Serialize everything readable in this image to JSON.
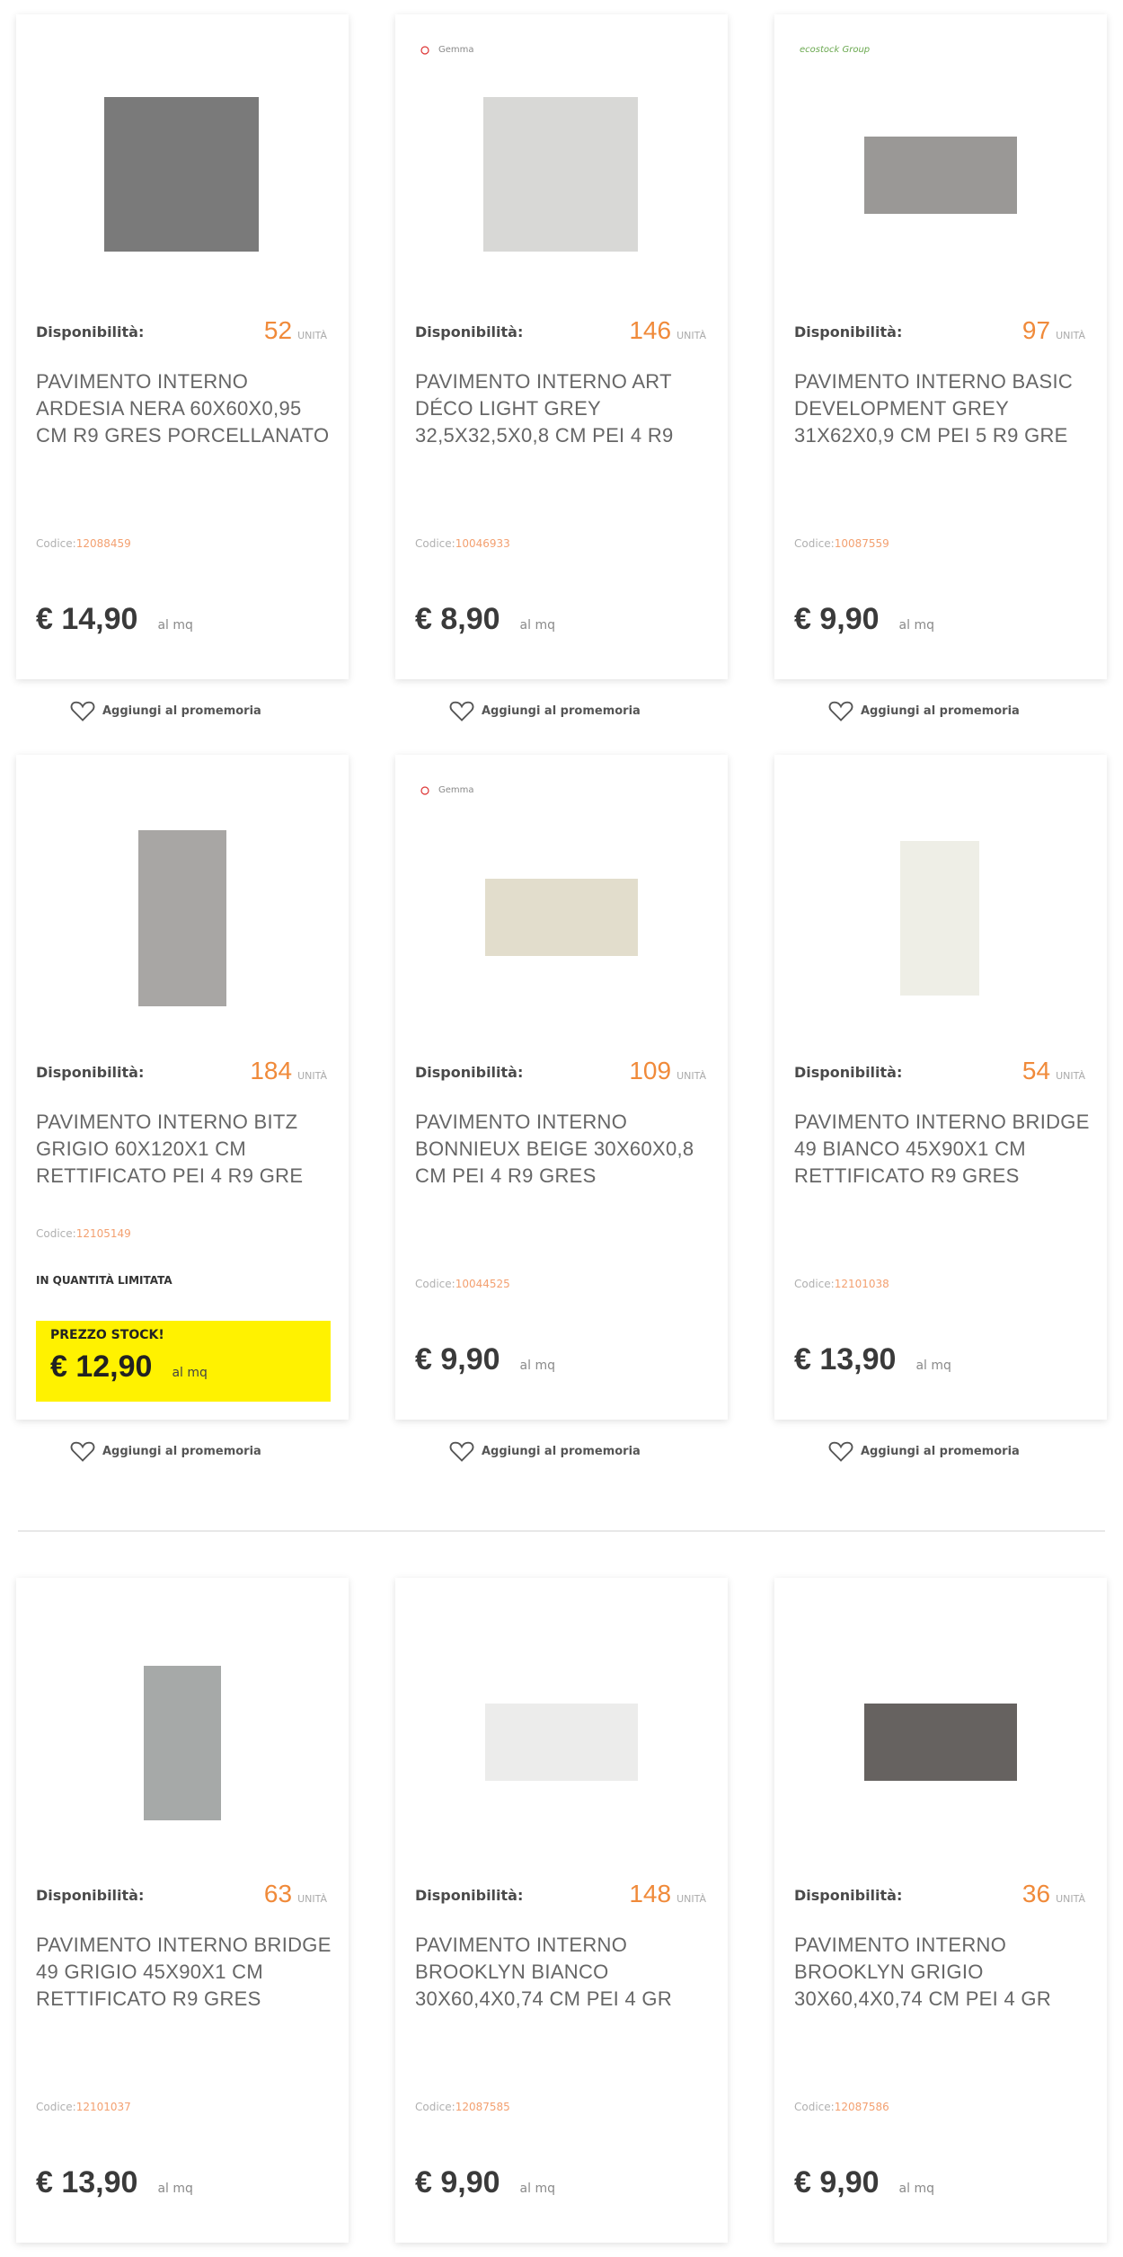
{
  "labels": {
    "availability": "Disponibilità:",
    "unit": "UNITÀ",
    "code_prefix": "Codice:",
    "per_unit": "al mq",
    "wishlist": "Aggiungi al promemoria",
    "limited_quantity": "IN QUANTITÀ LIMITATA",
    "stock_price": "PREZZO STOCK!"
  },
  "products": [
    {
      "brand": "",
      "availability": "52",
      "name": "PAVIMENTO INTERNO ARDESIA NERA 60X60X0,95 CM R9 GRES PORCELLANATO",
      "code": "12088459",
      "price": "€ 14,90",
      "image_color": "#7a7a7a"
    },
    {
      "brand": "Gemma",
      "availability": "146",
      "name": "PAVIMENTO INTERNO ART DÉCO LIGHT GREY 32,5X32,5X0,8 CM PEI 4 R9",
      "code": "10046933",
      "price": "€ 8,90",
      "image_color": "#d8d8d6"
    },
    {
      "brand": "ecostock Group",
      "availability": "97",
      "name": "PAVIMENTO INTERNO BASIC DEVELOPMENT GREY 31X62X0,9 CM PEI 5 R9 GRE",
      "code": "10087559",
      "price": "€ 9,90",
      "image_color": "#9a9896"
    },
    {
      "brand": "",
      "availability": "184",
      "name": "PAVIMENTO INTERNO BITZ GRIGIO 60X120X1 CM RETTIFICATO PEI 4 R9 GRE",
      "code": "12105149",
      "price": "€ 12,90",
      "limited": true,
      "image_color": "#a8a6a4"
    },
    {
      "brand": "Gemma",
      "availability": "109",
      "name": "PAVIMENTO INTERNO BONNIEUX BEIGE 30X60X0,8 CM PEI 4 R9 GRES",
      "code": "10044525",
      "price": "€ 9,90",
      "image_color": "#e2ddcc"
    },
    {
      "brand": "",
      "availability": "54",
      "name": "PAVIMENTO INTERNO BRIDGE 49 BIANCO 45X90X1 CM RETTIFICATO R9 GRES",
      "code": "12101038",
      "price": "€ 13,90",
      "image_color": "#eeeee6"
    },
    {
      "brand": "",
      "availability": "63",
      "name": "PAVIMENTO INTERNO BRIDGE 49 GRIGIO 45X90X1 CM RETTIFICATO R9 GRES",
      "code": "12101037",
      "price": "€ 13,90",
      "image_color": "#a6a9a8"
    },
    {
      "brand": "",
      "availability": "148",
      "name": "PAVIMENTO INTERNO BROOKLYN BIANCO 30X60,4X0,74 CM PEI 4 GR",
      "code": "12087585",
      "price": "€ 9,90",
      "image_color": "#ececeb"
    },
    {
      "brand": "",
      "availability": "36",
      "name": "PAVIMENTO INTERNO BROOKLYN GRIGIO 30X60,4X0,74 CM PEI 4 GR",
      "code": "12087586",
      "price": "€ 9,90",
      "image_color": "#666260"
    }
  ]
}
